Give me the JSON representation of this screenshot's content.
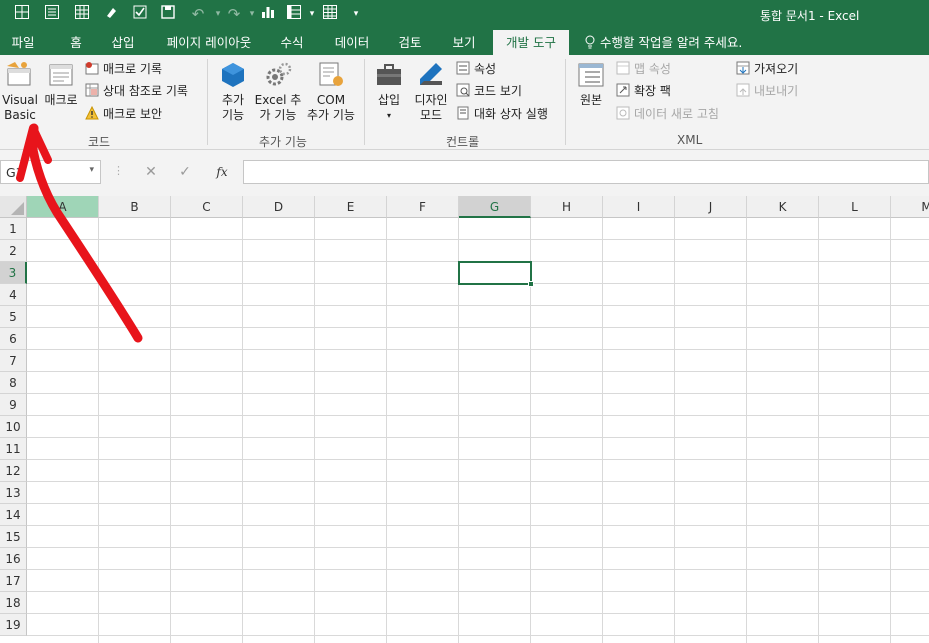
{
  "window": {
    "title": "통합 문서1 - Excel"
  },
  "tabs": [
    "파일",
    "홈",
    "삽입",
    "페이지 레이아웃",
    "수식",
    "데이터",
    "검토",
    "보기",
    "개발 도구"
  ],
  "active_tab": "개발 도구",
  "tell_me": "수행할 작업을 알려 주세요.",
  "ribbon": {
    "code": {
      "label": "코드",
      "visual_basic": [
        "Visual",
        "Basic"
      ],
      "macros": "매크로",
      "record_macro": "매크로 기록",
      "relative_ref": "상대 참조로 기록",
      "macro_security": "매크로 보안"
    },
    "addins": {
      "label": "추가 기능",
      "addins": [
        "추가",
        "기능"
      ],
      "excel_addins": [
        "Excel 추",
        "가 기능"
      ],
      "com_addins": [
        "COM",
        "추가 기능"
      ]
    },
    "controls": {
      "label": "컨트롤",
      "insert": "삽입",
      "design_mode": [
        "디자인",
        "모드"
      ],
      "properties": "속성",
      "view_code": "코드 보기",
      "run_dialog": "대화 상자 실행"
    },
    "xml": {
      "label": "XML",
      "source": "원본",
      "map_properties": "맵 속성",
      "expansion_packs": "확장 팩",
      "refresh_data": "데이터 새로 고침",
      "import": "가져오기",
      "export": "내보내기"
    }
  },
  "formula_bar": {
    "name_box": "G3",
    "cancel": "✕",
    "enter": "✓",
    "fx": "fx",
    "value": ""
  },
  "columns": [
    "A",
    "B",
    "C",
    "D",
    "E",
    "F",
    "G",
    "H",
    "I",
    "J",
    "K",
    "L",
    "M"
  ],
  "rows": [
    "1",
    "2",
    "3",
    "4",
    "5",
    "6",
    "7",
    "8",
    "9",
    "10",
    "11",
    "12",
    "13",
    "14",
    "15",
    "16",
    "17",
    "18",
    "19"
  ],
  "selected_cell": {
    "column": "G",
    "row": "3"
  },
  "colors": {
    "excel_green": "#217346",
    "annotation_red": "#e8141b"
  }
}
